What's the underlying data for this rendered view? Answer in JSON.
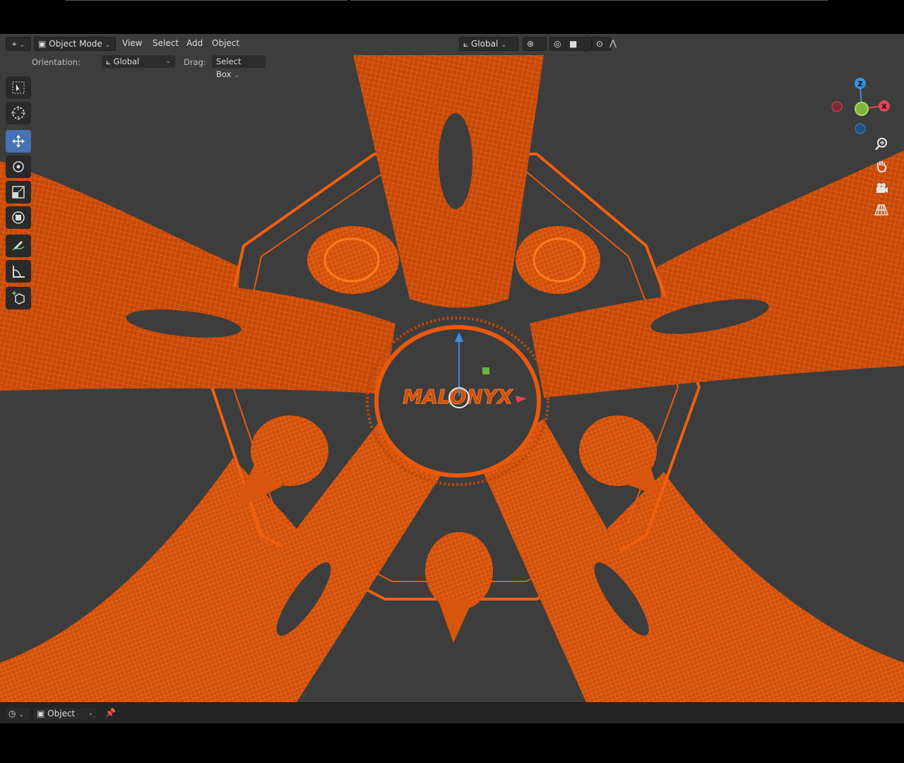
{
  "header": {
    "mode_label": "Object Mode",
    "menus": [
      "View",
      "Select",
      "Add",
      "Object"
    ],
    "transform_orientation": "Global"
  },
  "tool_settings": {
    "orientation_label": "Orientation:",
    "orientation_value": "Global",
    "drag_label": "Drag:",
    "drag_value": "Select Box"
  },
  "toolbar": {
    "tools": [
      "select-box-icon",
      "cursor-icon",
      "move-icon",
      "rotate-icon",
      "scale-icon",
      "transform-icon",
      "annotate-icon",
      "measure-icon",
      "add-cube-icon"
    ],
    "active_tool": "move-icon"
  },
  "gizmo": {
    "axes": [
      "Z",
      "X"
    ]
  },
  "viewport": {
    "logo_text": "MALONYX",
    "wire_color": "#e35b0e",
    "background_color": "#3d3d3d"
  },
  "footer": {
    "context_label": "Object"
  },
  "colors": {
    "accent": "#4772b3",
    "axis_x": "#e0455a",
    "axis_y": "#7bb33b",
    "axis_z": "#3b8ee0"
  }
}
